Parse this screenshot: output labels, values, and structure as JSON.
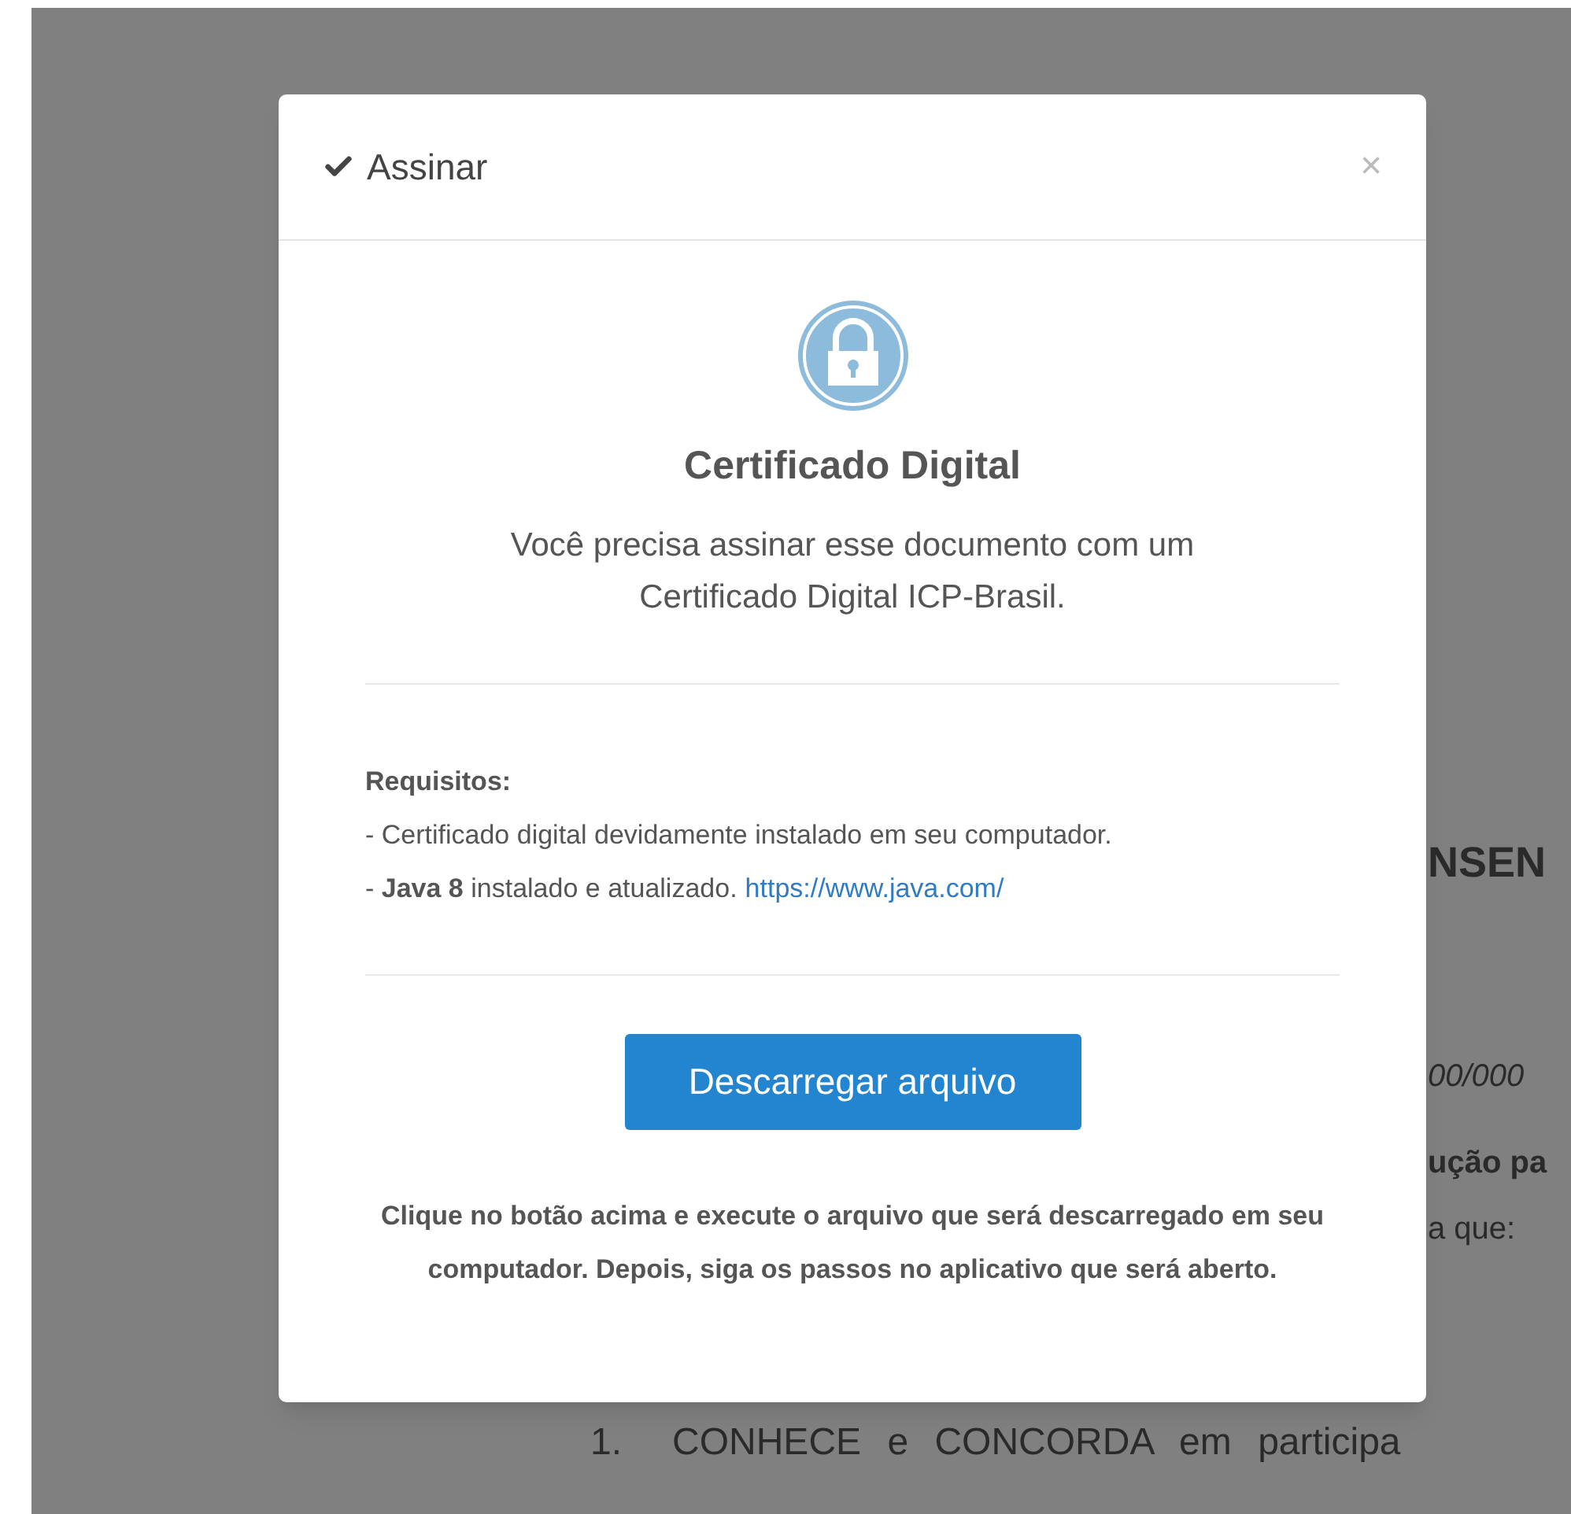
{
  "modal": {
    "title": "Assinar",
    "close": "×",
    "heading": "Certificado Digital",
    "description": "Você precisa assinar esse documento com um Certificado Digital ICP-Brasil.",
    "requirements_title": "Requisitos:",
    "requirements": [
      {
        "text": "- Certificado digital devidamente instalado em seu computador."
      },
      {
        "text": "- **Java 8** instalado e atualizado.",
        "link": "https://www.java.com/"
      }
    ],
    "button": "Descarregar arquivo",
    "note": "Clique no botão acima e execute o arquivo que será descarregado em seu computador. Depois, siga os passos no aplicativo que será aberto."
  },
  "background_document": {
    "heading": "NSEN",
    "fragments": [
      {
        "text": "00/000",
        "kind": "italic"
      },
      {
        "text": "ução pa",
        "kind": "bold"
      },
      {
        "text": "a que:",
        "kind": "plain"
      }
    ],
    "list_item": {
      "number": "1.",
      "text": "CONHECE e CONCORDA em participa"
    }
  }
}
